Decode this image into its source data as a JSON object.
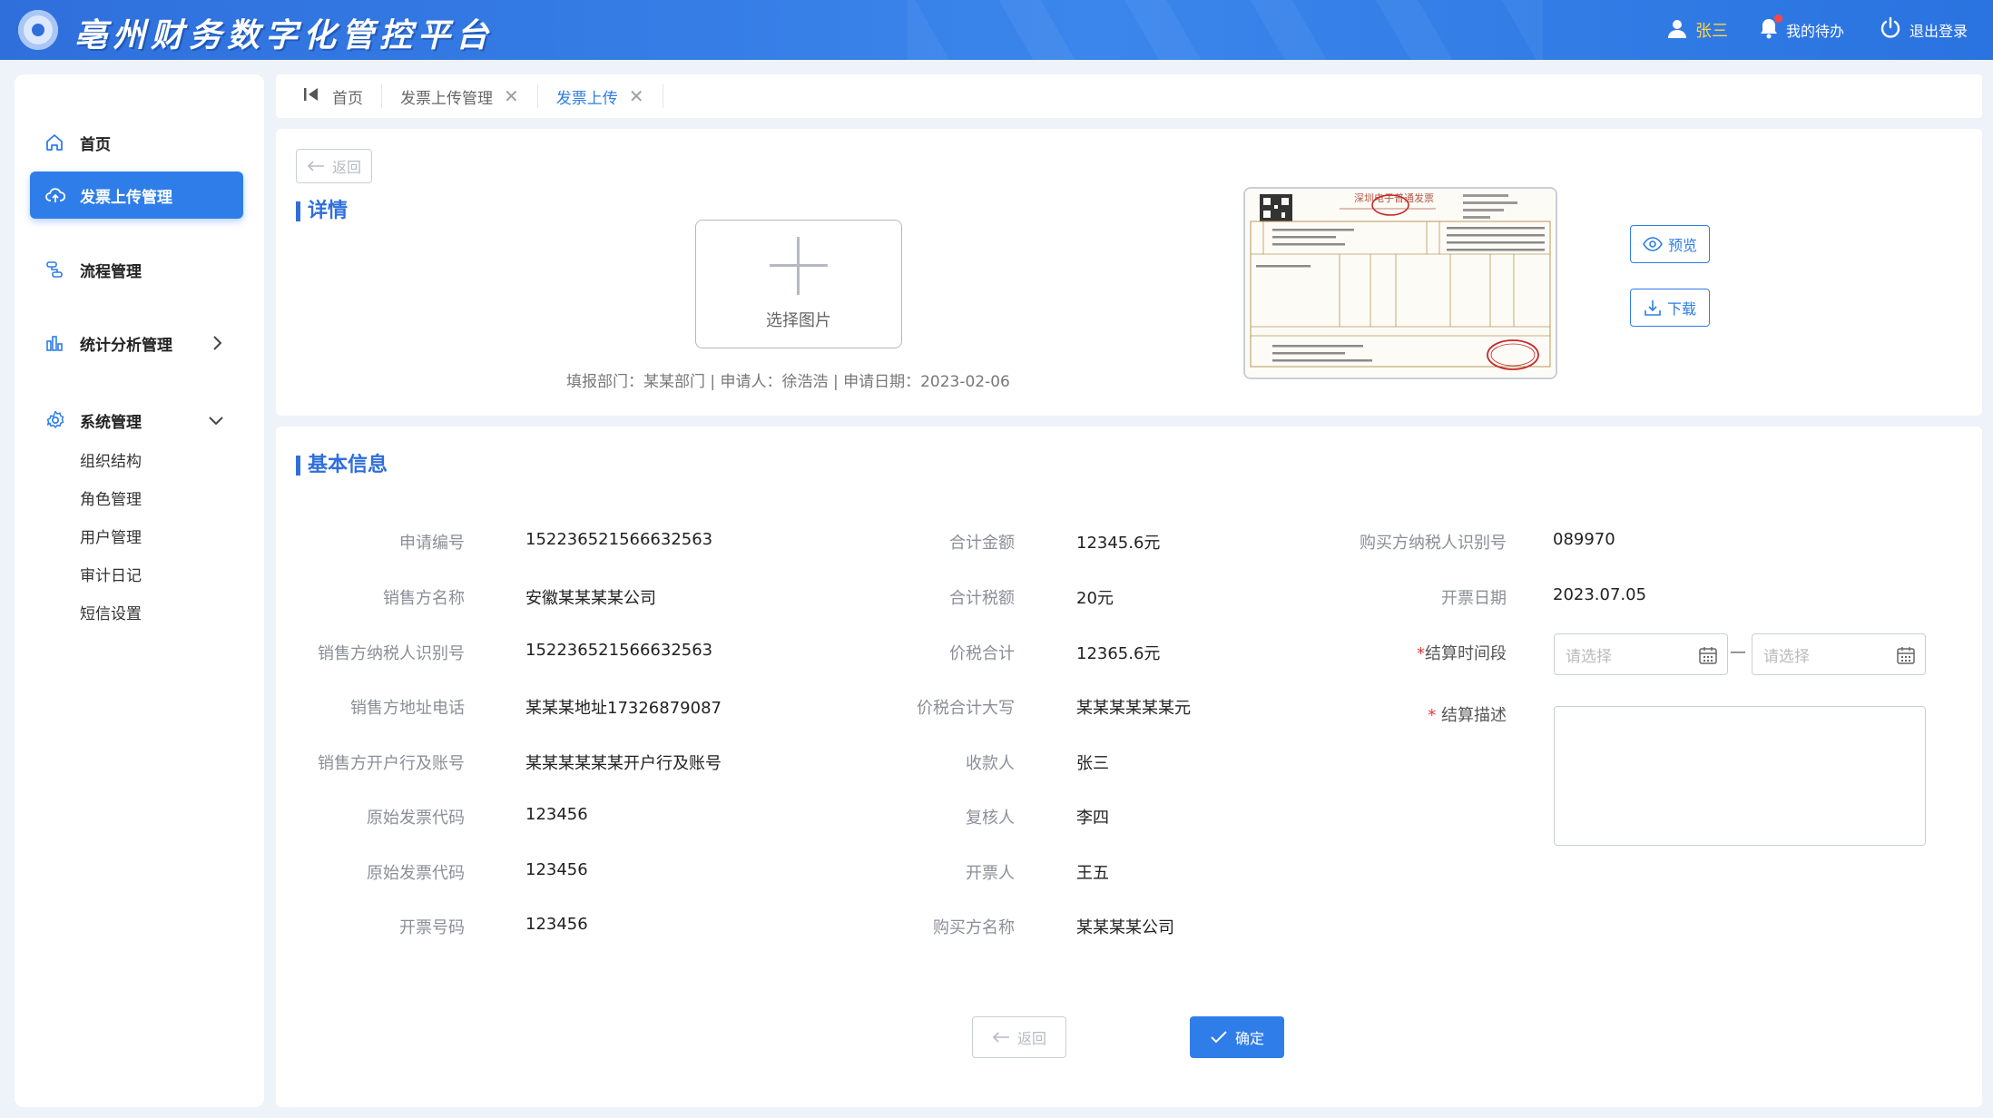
{
  "header": {
    "app_title": "亳州财务数字化管控平台",
    "user_name": "张三",
    "todo_label": "我的待办",
    "logout_label": "退出登录"
  },
  "sidebar": {
    "items": [
      {
        "label": "首页",
        "icon": "home-icon"
      },
      {
        "label": "发票上传管理",
        "icon": "cloud-upload-icon"
      },
      {
        "label": "流程管理",
        "icon": "flow-icon"
      },
      {
        "label": "统计分析管理",
        "icon": "bar-chart-icon"
      },
      {
        "label": "系统管理",
        "icon": "gear-icon"
      }
    ],
    "sub_items": [
      "组织结构",
      "角色管理",
      "用户管理",
      "审计日记",
      "短信设置"
    ]
  },
  "tabs": [
    {
      "label": "首页"
    },
    {
      "label": "发票上传管理"
    },
    {
      "label": "发票上传"
    }
  ],
  "detail": {
    "back_label": "返回",
    "title": "详情",
    "upload_label": "选择图片",
    "meta_line": "填报部门：某某部门 | 申请人：徐浩浩 | 申请日期：2023-02-06",
    "preview_label": "预览",
    "download_label": "下载",
    "invoice_title": "深圳电子普通发票"
  },
  "basic": {
    "title": "基本信息",
    "col1": [
      {
        "label": "申请编号",
        "value": "152236521566632563"
      },
      {
        "label": "销售方名称",
        "value": "安徽某某某某公司"
      },
      {
        "label": "销售方纳税人识别号",
        "value": "152236521566632563"
      },
      {
        "label": "销售方地址电话",
        "value": "某某某地址17326879087"
      },
      {
        "label": "销售方开户行及账号",
        "value": "某某某某某某开户行及账号"
      },
      {
        "label": "原始发票代码",
        "value": "123456"
      },
      {
        "label": "原始发票代码",
        "value": "123456"
      },
      {
        "label": "开票号码",
        "value": "123456"
      }
    ],
    "col2": [
      {
        "label": "合计金额",
        "value": "12345.6元"
      },
      {
        "label": "合计税额",
        "value": "20元"
      },
      {
        "label": "价税合计",
        "value": "12365.6元"
      },
      {
        "label": "价税合计大写",
        "value": "某某某某某某元"
      },
      {
        "label": "收款人",
        "value": "张三"
      },
      {
        "label": "复核人",
        "value": "李四"
      },
      {
        "label": "开票人",
        "value": "王五"
      },
      {
        "label": "购买方名称",
        "value": "某某某某公司"
      }
    ],
    "col3": [
      {
        "label": "购买方纳税人识别号",
        "value": "089970"
      },
      {
        "label": "开票日期",
        "value": "2023.07.05"
      }
    ],
    "period_label": "结算时间段",
    "date_placeholder": "请选择",
    "range_separator": "—",
    "desc_label": "结算描述",
    "required_mark": "*",
    "back_label": "返回",
    "confirm_label": "确定"
  }
}
